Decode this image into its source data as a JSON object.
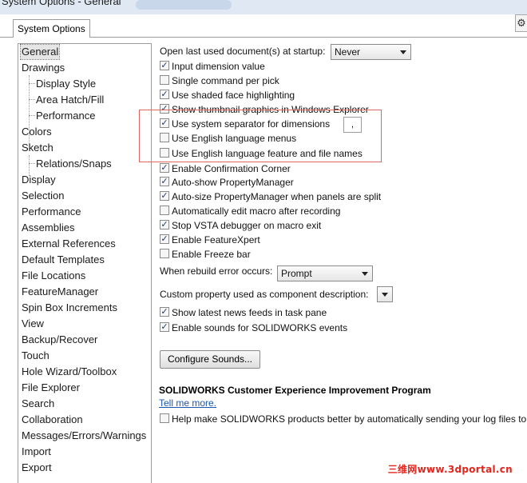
{
  "window": {
    "title": "System Options - General"
  },
  "tab": {
    "label": "System Options"
  },
  "help_icon": "gear-icon",
  "tree": {
    "items": [
      {
        "label": "General",
        "selected": true
      },
      {
        "label": "Drawings"
      },
      {
        "label": "Display Style",
        "child": true
      },
      {
        "label": "Area Hatch/Fill",
        "child": true
      },
      {
        "label": "Performance",
        "child": true
      },
      {
        "label": "Colors"
      },
      {
        "label": "Sketch"
      },
      {
        "label": "Relations/Snaps",
        "child": true
      },
      {
        "label": "Display"
      },
      {
        "label": "Selection"
      },
      {
        "label": "Performance"
      },
      {
        "label": "Assemblies"
      },
      {
        "label": "External References"
      },
      {
        "label": "Default Templates"
      },
      {
        "label": "File Locations"
      },
      {
        "label": "FeatureManager"
      },
      {
        "label": "Spin Box Increments"
      },
      {
        "label": "View"
      },
      {
        "label": "Backup/Recover"
      },
      {
        "label": "Touch"
      },
      {
        "label": "Hole Wizard/Toolbox"
      },
      {
        "label": "File Explorer"
      },
      {
        "label": "Search"
      },
      {
        "label": "Collaboration"
      },
      {
        "label": "Messages/Errors/Warnings"
      },
      {
        "label": "Import"
      },
      {
        "label": "Export"
      }
    ]
  },
  "general": {
    "open_last_label": "Open last used document(s) at startup:",
    "open_last_value": "Never",
    "options": [
      {
        "label": "Input dimension value",
        "checked": true
      },
      {
        "label": "Single command per pick",
        "checked": false
      },
      {
        "label": "Use shaded face highlighting",
        "checked": true
      },
      {
        "label": "Show thumbnail graphics in Windows Explorer",
        "checked": true
      },
      {
        "label": "Use system separator for dimensions",
        "checked": true
      },
      {
        "label": "Use English language menus",
        "checked": false
      },
      {
        "label": "Use English language feature and file names",
        "checked": false
      },
      {
        "label": "Enable Confirmation Corner",
        "checked": true
      },
      {
        "label": "Auto-show PropertyManager",
        "checked": true
      },
      {
        "label": "Auto-size PropertyManager when panels are split",
        "checked": true
      },
      {
        "label": "Automatically edit macro after recording",
        "checked": false
      },
      {
        "label": "Stop VSTA debugger on macro exit",
        "checked": true
      },
      {
        "label": "Enable FeatureXpert",
        "checked": true
      },
      {
        "label": "Enable Freeze bar",
        "checked": false
      }
    ],
    "separator_value": ",",
    "rebuild_label": "When rebuild error occurs:",
    "rebuild_value": "Prompt",
    "custom_prop_label": "Custom property used as component description:",
    "custom_prop_value": "",
    "news_label": "Show latest news feeds in task pane",
    "news_checked": true,
    "sounds_label": "Enable sounds for SOLIDWORKS events",
    "sounds_checked": true,
    "configure_sounds": "Configure Sounds...",
    "ceip_heading": "SOLIDWORKS Customer Experience Improvement Program",
    "tell_me_more": "Tell me more.",
    "ceip_label": "Help make SOLIDWORKS products better by automatically sending your log files to DS",
    "ceip_checked": false
  },
  "watermark": "三维网www.3dportal.cn"
}
